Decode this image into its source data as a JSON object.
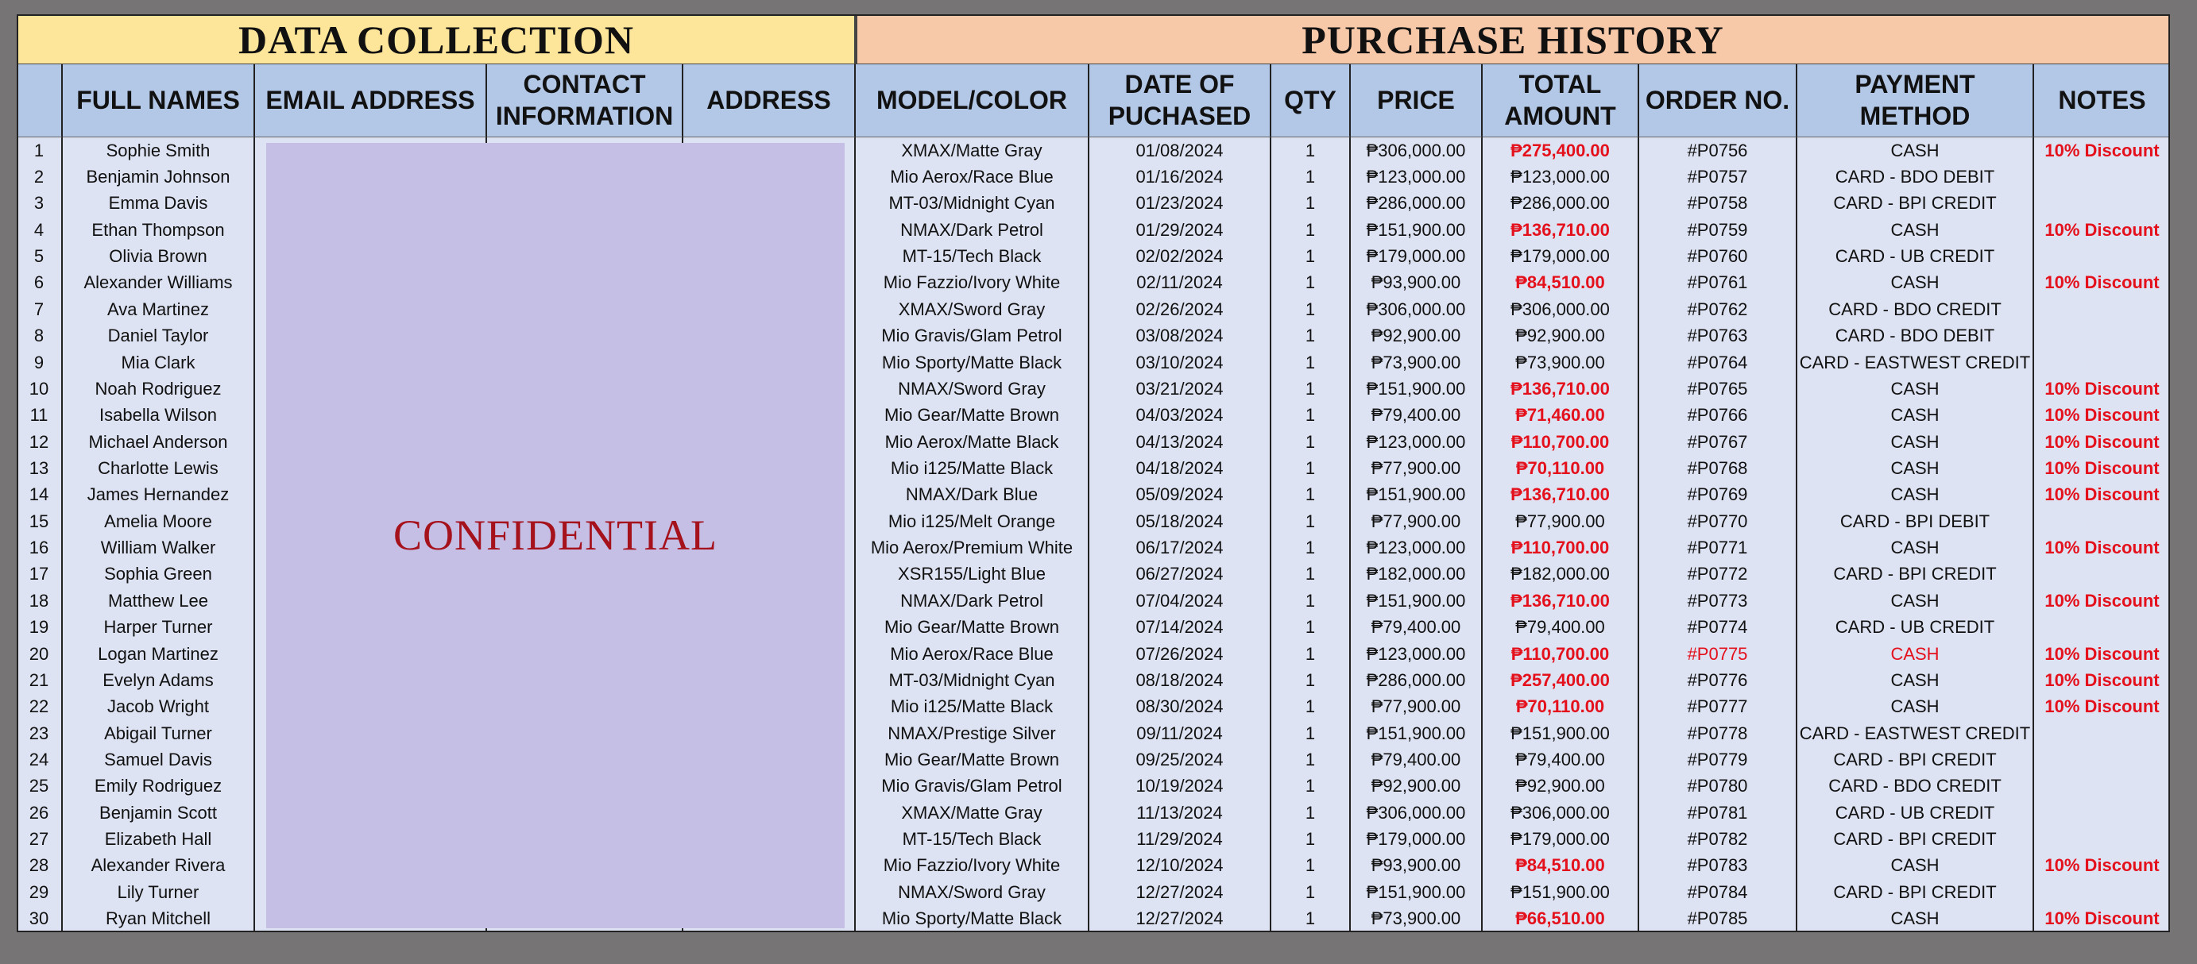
{
  "banners": {
    "data_collection": "DATA COLLECTION",
    "purchase_history": "PURCHASE HISTORY"
  },
  "headers": {
    "no": "",
    "full_names": "FULL NAMES",
    "email": "EMAIL ADDRESS",
    "contact_l1": "CONTACT",
    "contact_l2": "INFORMATION",
    "address": "ADDRESS",
    "model": "MODEL/COLOR",
    "date_l1": "DATE OF",
    "date_l2": "PUCHASED",
    "qty": "QTY",
    "price": "PRICE",
    "total_l1": "TOTAL",
    "total_l2": "AMOUNT",
    "order": "ORDER NO.",
    "payment_l1": "PAYMENT",
    "payment_l2": "METHOD",
    "notes": "NOTES"
  },
  "confidential_label": "CONFIDENTIAL",
  "colors": {
    "data_collection_banner": "#fde599",
    "purchase_history_banner": "#f8c9a9",
    "header_bg": "#b3c7e6",
    "body_bg": "#dde3f2",
    "confidential_bg": "#c5bfe6",
    "confidential_text": "#a5121c",
    "discount_red": "#e4101c",
    "outer_bg": "#767474"
  },
  "rows": [
    {
      "no": "1",
      "name": "Sophie Smith",
      "model": "XMAX/Matte Gray",
      "date": "01/08/2024",
      "qty": "1",
      "price": "₱306,000.00",
      "total": "₱275,400.00",
      "order": "#P0756",
      "payment": "CASH",
      "notes": "10% Discount",
      "total_red": true
    },
    {
      "no": "2",
      "name": "Benjamin Johnson",
      "model": "Mio Aerox/Race Blue",
      "date": "01/16/2024",
      "qty": "1",
      "price": "₱123,000.00",
      "total": "₱123,000.00",
      "order": "#P0757",
      "payment": "CARD - BDO DEBIT",
      "notes": "",
      "total_red": false
    },
    {
      "no": "3",
      "name": "Emma Davis",
      "model": "MT-03/Midnight Cyan",
      "date": "01/23/2024",
      "qty": "1",
      "price": "₱286,000.00",
      "total": "₱286,000.00",
      "order": "#P0758",
      "payment": "CARD - BPI CREDIT",
      "notes": "",
      "total_red": false
    },
    {
      "no": "4",
      "name": "Ethan Thompson",
      "model": "NMAX/Dark Petrol",
      "date": "01/29/2024",
      "qty": "1",
      "price": "₱151,900.00",
      "total": "₱136,710.00",
      "order": "#P0759",
      "payment": "CASH",
      "notes": "10% Discount",
      "total_red": true
    },
    {
      "no": "5",
      "name": "Olivia Brown",
      "model": "MT-15/Tech Black",
      "date": "02/02/2024",
      "qty": "1",
      "price": "₱179,000.00",
      "total": "₱179,000.00",
      "order": "#P0760",
      "payment": "CARD - UB CREDIT",
      "notes": "",
      "total_red": false
    },
    {
      "no": "6",
      "name": "Alexander Williams",
      "model": "Mio Fazzio/Ivory White",
      "date": "02/11/2024",
      "qty": "1",
      "price": "₱93,900.00",
      "total": "₱84,510.00",
      "order": "#P0761",
      "payment": "CASH",
      "notes": "10% Discount",
      "total_red": true
    },
    {
      "no": "7",
      "name": "Ava Martinez",
      "model": "XMAX/Sword Gray",
      "date": "02/26/2024",
      "qty": "1",
      "price": "₱306,000.00",
      "total": "₱306,000.00",
      "order": "#P0762",
      "payment": "CARD - BDO CREDIT",
      "notes": "",
      "total_red": false
    },
    {
      "no": "8",
      "name": "Daniel Taylor",
      "model": "Mio Gravis/Glam Petrol",
      "date": "03/08/2024",
      "qty": "1",
      "price": "₱92,900.00",
      "total": "₱92,900.00",
      "order": "#P0763",
      "payment": "CARD - BDO DEBIT",
      "notes": "",
      "total_red": false
    },
    {
      "no": "9",
      "name": "Mia Clark",
      "model": "Mio Sporty/Matte Black",
      "date": "03/10/2024",
      "qty": "1",
      "price": "₱73,900.00",
      "total": "₱73,900.00",
      "order": "#P0764",
      "payment": "CARD - EASTWEST CREDIT",
      "notes": "",
      "total_red": false
    },
    {
      "no": "10",
      "name": "Noah Rodriguez",
      "model": "NMAX/Sword Gray",
      "date": "03/21/2024",
      "qty": "1",
      "price": "₱151,900.00",
      "total": "₱136,710.00",
      "order": "#P0765",
      "payment": "CASH",
      "notes": "10% Discount",
      "total_red": true
    },
    {
      "no": "11",
      "name": "Isabella Wilson",
      "model": "Mio Gear/Matte Brown",
      "date": "04/03/2024",
      "qty": "1",
      "price": "₱79,400.00",
      "total": "₱71,460.00",
      "order": "#P0766",
      "payment": "CASH",
      "notes": "10% Discount",
      "total_red": true
    },
    {
      "no": "12",
      "name": "Michael Anderson",
      "model": "Mio Aerox/Matte Black",
      "date": "04/13/2024",
      "qty": "1",
      "price": "₱123,000.00",
      "total": "₱110,700.00",
      "order": "#P0767",
      "payment": "CASH",
      "notes": "10% Discount",
      "total_red": true
    },
    {
      "no": "13",
      "name": "Charlotte Lewis",
      "model": "Mio i125/Matte Black",
      "date": "04/18/2024",
      "qty": "1",
      "price": "₱77,900.00",
      "total": "₱70,110.00",
      "order": "#P0768",
      "payment": "CASH",
      "notes": "10% Discount",
      "total_red": true
    },
    {
      "no": "14",
      "name": "James Hernandez",
      "model": "NMAX/Dark Blue",
      "date": "05/09/2024",
      "qty": "1",
      "price": "₱151,900.00",
      "total": "₱136,710.00",
      "order": "#P0769",
      "payment": "CASH",
      "notes": "10% Discount",
      "total_red": true
    },
    {
      "no": "15",
      "name": "Amelia Moore",
      "model": "Mio i125/Melt Orange",
      "date": "05/18/2024",
      "qty": "1",
      "price": "₱77,900.00",
      "total": "₱77,900.00",
      "order": "#P0770",
      "payment": "CARD - BPI DEBIT",
      "notes": "",
      "total_red": false
    },
    {
      "no": "16",
      "name": "William Walker",
      "model": "Mio Aerox/Premium White",
      "date": "06/17/2024",
      "qty": "1",
      "price": "₱123,000.00",
      "total": "₱110,700.00",
      "order": "#P0771",
      "payment": "CASH",
      "notes": "10% Discount",
      "total_red": true
    },
    {
      "no": "17",
      "name": "Sophia Green",
      "model": "XSR155/Light Blue",
      "date": "06/27/2024",
      "qty": "1",
      "price": "₱182,000.00",
      "total": "₱182,000.00",
      "order": "#P0772",
      "payment": "CARD - BPI CREDIT",
      "notes": "",
      "total_red": false
    },
    {
      "no": "18",
      "name": "Matthew Lee",
      "model": "NMAX/Dark Petrol",
      "date": "07/04/2024",
      "qty": "1",
      "price": "₱151,900.00",
      "total": "₱136,710.00",
      "order": "#P0773",
      "payment": "CASH",
      "notes": "10% Discount",
      "total_red": true
    },
    {
      "no": "19",
      "name": "Harper Turner",
      "model": "Mio Gear/Matte Brown",
      "date": "07/14/2024",
      "qty": "1",
      "price": "₱79,400.00",
      "total": "₱79,400.00",
      "order": "#P0774",
      "payment": "CARD - UB CREDIT",
      "notes": "",
      "total_red": false
    },
    {
      "no": "20",
      "name": "Logan Martinez",
      "model": "Mio Aerox/Race Blue",
      "date": "07/26/2024",
      "qty": "1",
      "price": "₱123,000.00",
      "total": "₱110,700.00",
      "order": "#P0775",
      "payment": "CASH",
      "notes": "10% Discount",
      "total_red": true,
      "order_red": true
    },
    {
      "no": "21",
      "name": "Evelyn Adams",
      "model": "MT-03/Midnight Cyan",
      "date": "08/18/2024",
      "qty": "1",
      "price": "₱286,000.00",
      "total": "₱257,400.00",
      "order": "#P0776",
      "payment": "CASH",
      "notes": "10% Discount",
      "total_red": true
    },
    {
      "no": "22",
      "name": "Jacob Wright",
      "model": "Mio i125/Matte Black",
      "date": "08/30/2024",
      "qty": "1",
      "price": "₱77,900.00",
      "total": "₱70,110.00",
      "order": "#P0777",
      "payment": "CASH",
      "notes": "10% Discount",
      "total_red": true
    },
    {
      "no": "23",
      "name": "Abigail Turner",
      "model": "NMAX/Prestige Silver",
      "date": "09/11/2024",
      "qty": "1",
      "price": "₱151,900.00",
      "total": "₱151,900.00",
      "order": "#P0778",
      "payment": "CARD - EASTWEST CREDIT",
      "notes": "",
      "total_red": false
    },
    {
      "no": "24",
      "name": "Samuel Davis",
      "model": "Mio Gear/Matte Brown",
      "date": "09/25/2024",
      "qty": "1",
      "price": "₱79,400.00",
      "total": "₱79,400.00",
      "order": "#P0779",
      "payment": "CARD - BPI CREDIT",
      "notes": "",
      "total_red": false
    },
    {
      "no": "25",
      "name": "Emily Rodriguez",
      "model": "Mio Gravis/Glam Petrol",
      "date": "10/19/2024",
      "qty": "1",
      "price": "₱92,900.00",
      "total": "₱92,900.00",
      "order": "#P0780",
      "payment": "CARD - BDO CREDIT",
      "notes": "",
      "total_red": false
    },
    {
      "no": "26",
      "name": "Benjamin Scott",
      "model": "XMAX/Matte Gray",
      "date": "11/13/2024",
      "qty": "1",
      "price": "₱306,000.00",
      "total": "₱306,000.00",
      "order": "#P0781",
      "payment": "CARD - UB CREDIT",
      "notes": "",
      "total_red": false
    },
    {
      "no": "27",
      "name": "Elizabeth Hall",
      "model": "MT-15/Tech Black",
      "date": "11/29/2024",
      "qty": "1",
      "price": "₱179,000.00",
      "total": "₱179,000.00",
      "order": "#P0782",
      "payment": "CARD - BPI CREDIT",
      "notes": "",
      "total_red": false
    },
    {
      "no": "28",
      "name": "Alexander Rivera",
      "model": "Mio Fazzio/Ivory White",
      "date": "12/10/2024",
      "qty": "1",
      "price": "₱93,900.00",
      "total": "₱84,510.00",
      "order": "#P0783",
      "payment": "CASH",
      "notes": "10% Discount",
      "total_red": true
    },
    {
      "no": "29",
      "name": "Lily Turner",
      "model": "NMAX/Sword Gray",
      "date": "12/27/2024",
      "qty": "1",
      "price": "₱151,900.00",
      "total": "₱151,900.00",
      "order": "#P0784",
      "payment": "CARD - BPI CREDIT",
      "notes": "",
      "total_red": false
    },
    {
      "no": "30",
      "name": "Ryan Mitchell",
      "model": "Mio Sporty/Matte Black",
      "date": "12/27/2024",
      "qty": "1",
      "price": "₱73,900.00",
      "total": "₱66,510.00",
      "order": "#P0785",
      "payment": "CASH",
      "notes": "10% Discount",
      "total_red": true
    }
  ]
}
